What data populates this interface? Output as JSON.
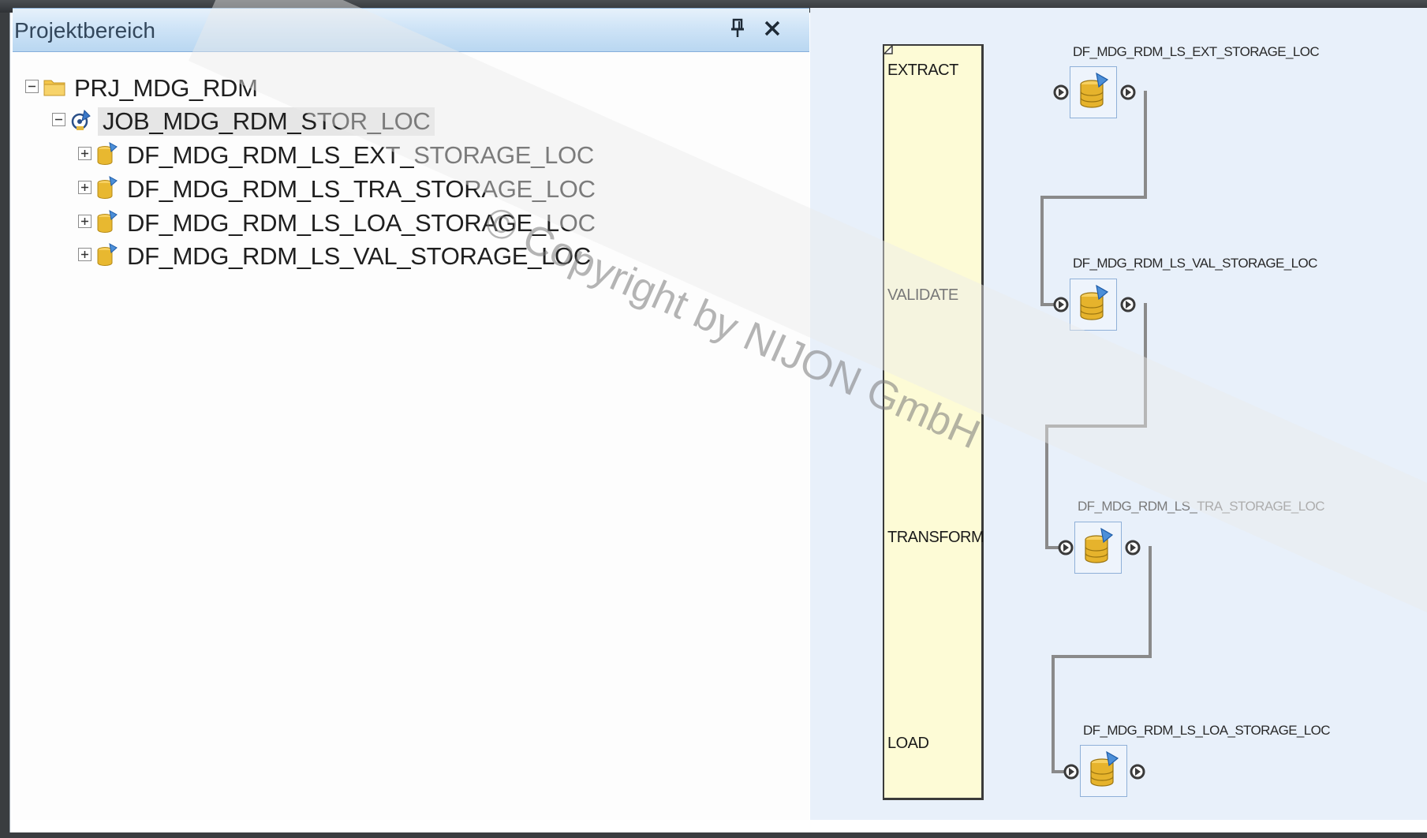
{
  "panel": {
    "title": "Projektbereich",
    "pin_icon": "pin-icon",
    "close_icon": "close-icon"
  },
  "tree": {
    "project": {
      "label": "PRJ_MDG_RDM",
      "icon": "folder-icon",
      "expander": "collapse"
    },
    "job": {
      "label": "JOB_MDG_RDM_STOR_LOC",
      "icon": "job-icon",
      "expander": "collapse"
    },
    "dataflows": [
      {
        "label": "DF_MDG_RDM_LS_EXT_STORAGE_LOC",
        "icon": "dataflow-icon",
        "expander": "expand"
      },
      {
        "label": "DF_MDG_RDM_LS_TRA_STORAGE_LOC",
        "icon": "dataflow-icon",
        "expander": "expand"
      },
      {
        "label": "DF_MDG_RDM_LS_LOA_STORAGE_LOC",
        "icon": "dataflow-icon",
        "expander": "expand"
      },
      {
        "label": "DF_MDG_RDM_LS_VAL_STORAGE_LOC",
        "icon": "dataflow-icon",
        "expander": "expand"
      }
    ]
  },
  "workspace": {
    "phases": [
      "EXTRACT",
      "VALIDATE",
      "TRANSFORM",
      "LOAD"
    ],
    "nodes": [
      {
        "title": "DF_MDG_RDM_LS_EXT_STORAGE_LOC"
      },
      {
        "title": "DF_MDG_RDM_LS_VAL_STORAGE_LOC"
      },
      {
        "title": "DF_MDG_RDM_LS_TRA_STORAGE_LOC"
      },
      {
        "title": "DF_MDG_RDM_LS_LOA_STORAGE_LOC"
      }
    ]
  },
  "watermark": "© Copyright by NIJON GmbH",
  "colors": {
    "header_blue": "#c4ddf4",
    "workspace_bg": "#e8f0fa",
    "phase_box": "#fdfbd6",
    "connector": "#8a8a8a"
  }
}
